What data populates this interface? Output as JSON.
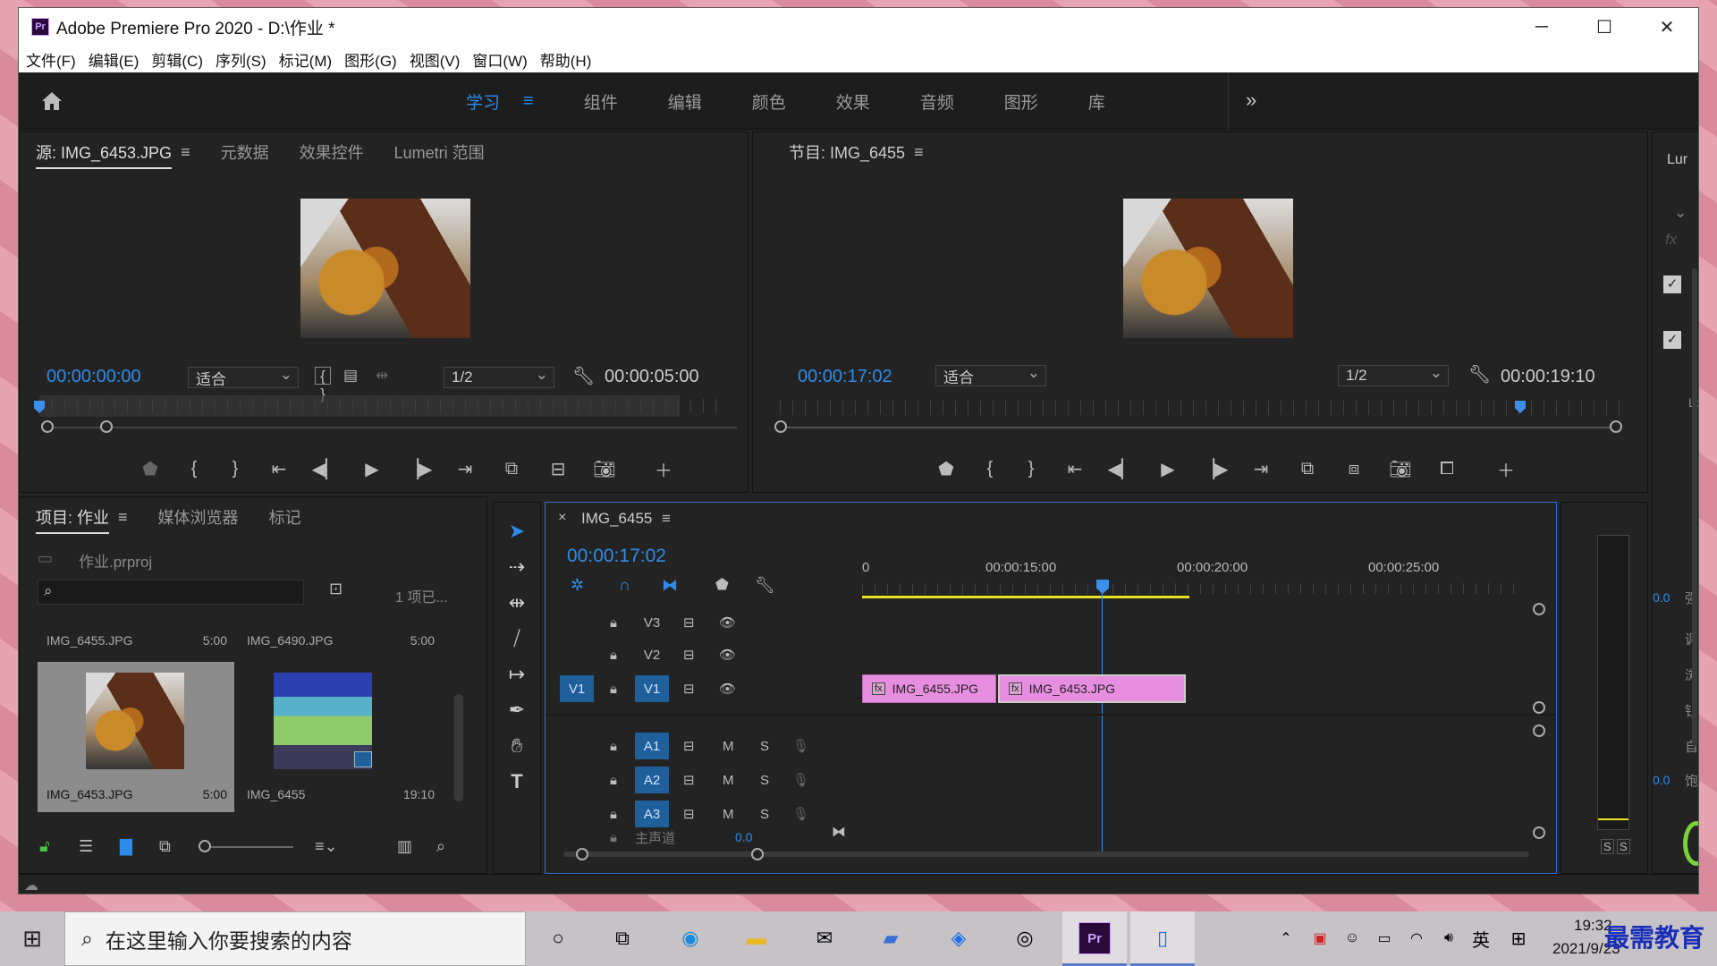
{
  "window": {
    "app_icon": "Pr",
    "title": "Adobe Premiere Pro 2020 - D:\\作业 *",
    "controls": [
      "─",
      "☐",
      "✕"
    ]
  },
  "menu": [
    "文件(F)",
    "编辑(E)",
    "剪辑(C)",
    "序列(S)",
    "标记(M)",
    "图形(G)",
    "视图(V)",
    "窗口(W)",
    "帮助(H)"
  ],
  "workspaces": {
    "active": "学习",
    "menu_glyph": "≡",
    "tabs": [
      "组件",
      "编辑",
      "颜色",
      "效果",
      "音频",
      "图形",
      "库"
    ],
    "more": "»"
  },
  "source_monitor": {
    "tabs": [
      "源: IMG_6453.JPG",
      "元数据",
      "效果控件",
      "Lumetri 范围"
    ],
    "menu_glyph": "≡",
    "timecode_current": "00:00:00:00",
    "fit": "适合",
    "resolution": "1/2",
    "timecode_duration": "00:00:05:00"
  },
  "program_monitor": {
    "title": "节目: IMG_6455",
    "menu_glyph": "≡",
    "timecode_current": "00:00:17:02",
    "fit": "适合",
    "resolution": "1/2",
    "timecode_duration": "00:00:19:10"
  },
  "right_panel": {
    "label": "Lur",
    "partial_labels": [
      "Lo",
      "0.0",
      "强",
      "调",
      "浏",
      "钐",
      "自",
      "0.0",
      "饱"
    ]
  },
  "project_panel": {
    "tabs": [
      "项目: 作业",
      "媒体浏览器",
      "标记"
    ],
    "menu_glyph": "≡",
    "file": "作业.prproj",
    "count": "1 项已...",
    "items": [
      {
        "name": "IMG_6455.JPG",
        "duration": "5:00"
      },
      {
        "name": "IMG_6490.JPG",
        "duration": "5:00"
      },
      {
        "name": "IMG_6453.JPG",
        "duration": "5:00"
      },
      {
        "name": "IMG_6455",
        "duration": "19:10"
      }
    ]
  },
  "timeline": {
    "close": "×",
    "sequence_name": "IMG_6455",
    "menu_glyph": "≡",
    "timecode": "00:00:17:02",
    "ruler_labels": [
      "0",
      "00:00:15:00",
      "00:00:20:00",
      "00:00:25:00"
    ],
    "video_tracks": [
      "V3",
      "V2",
      "V1"
    ],
    "source_patch": "V1",
    "audio_tracks": [
      "A1",
      "A2",
      "A3"
    ],
    "audio_m": "M",
    "audio_s": "S",
    "fx_badge": "fx",
    "master": "主声道",
    "master_value": "0.0",
    "clips": [
      {
        "name": "IMG_6455.JPG"
      },
      {
        "name": "IMG_6453.JPG"
      }
    ]
  },
  "audio_meter": {
    "labels": [
      "S",
      "S"
    ]
  },
  "taskbar": {
    "search_placeholder": "在这里输入你要搜索的内容",
    "ime": "英",
    "time": "19:32",
    "date": "2021/9/23",
    "watermark": "最需教育"
  }
}
